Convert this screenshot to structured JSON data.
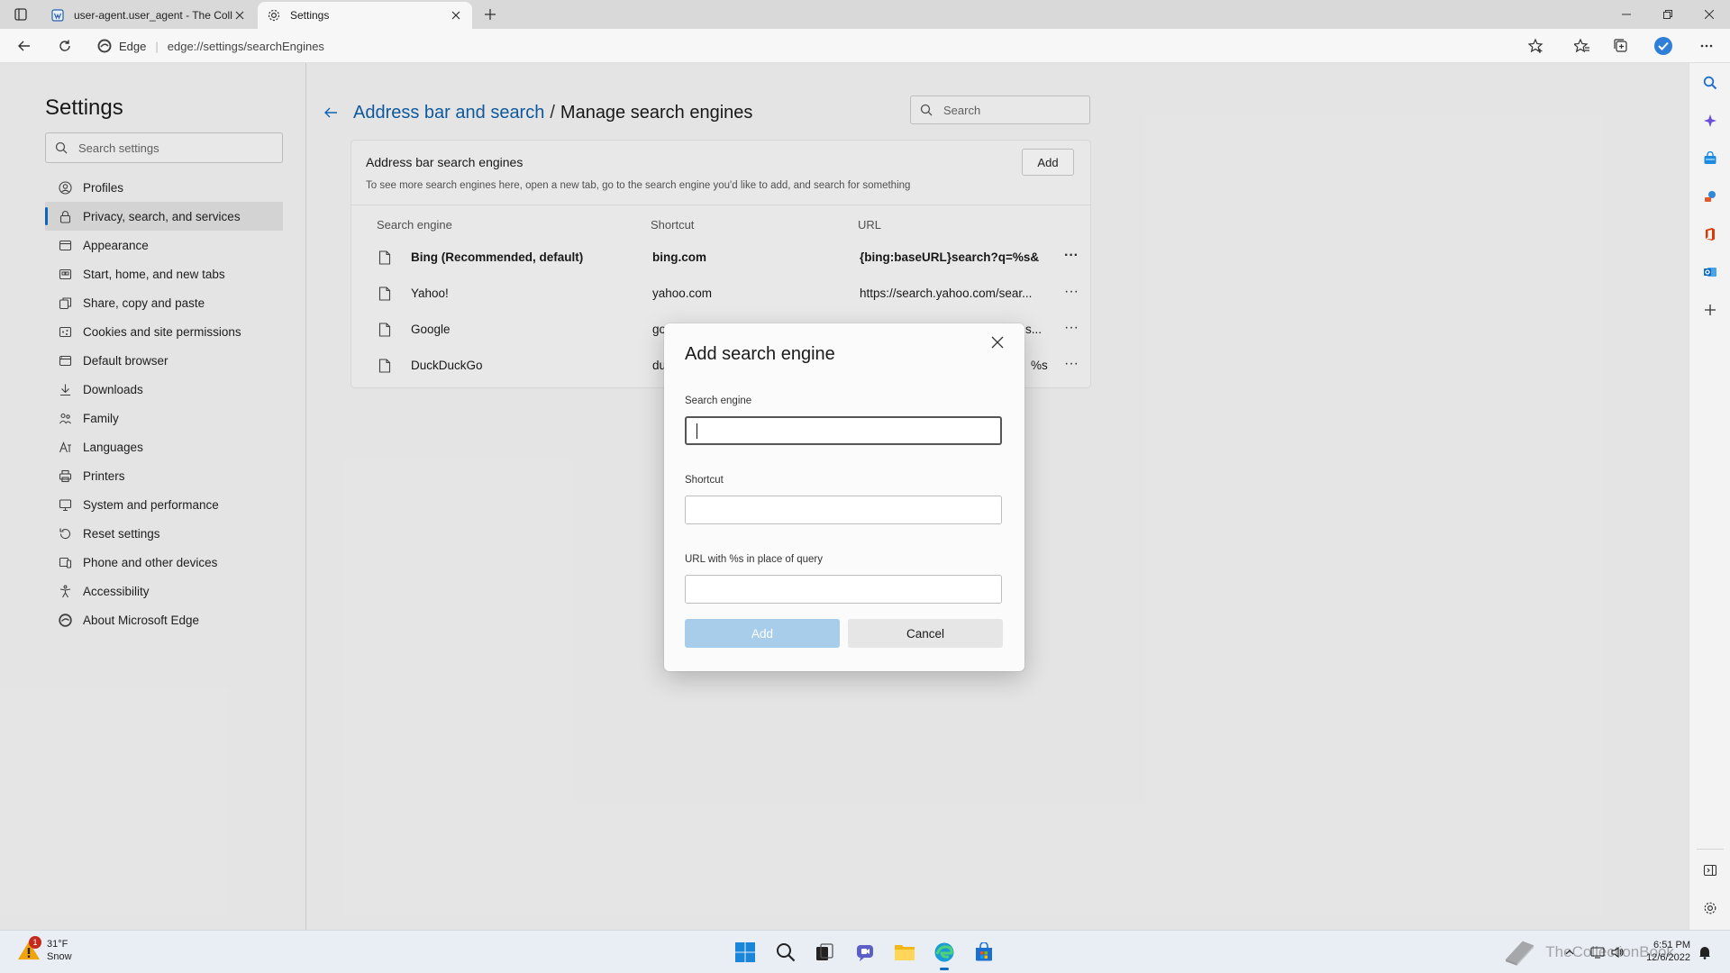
{
  "browser": {
    "tabs": [
      {
        "label": "user-agent.user_agent - The Coll",
        "icon": "page-icon"
      },
      {
        "label": "Settings",
        "icon": "gear-icon"
      }
    ],
    "address": {
      "site_label": "Edge",
      "url": "edge://settings/searchEngines"
    }
  },
  "sidebar": {
    "title": "Settings",
    "search_placeholder": "Search settings",
    "items": [
      {
        "label": "Profiles",
        "icon": "person-icon"
      },
      {
        "label": "Privacy, search, and services",
        "icon": "lock-icon",
        "active": true
      },
      {
        "label": "Appearance",
        "icon": "appearance-icon"
      },
      {
        "label": "Start, home, and new tabs",
        "icon": "home-icon"
      },
      {
        "label": "Share, copy and paste",
        "icon": "share-icon"
      },
      {
        "label": "Cookies and site permissions",
        "icon": "cookie-icon"
      },
      {
        "label": "Default browser",
        "icon": "browser-icon"
      },
      {
        "label": "Downloads",
        "icon": "download-icon"
      },
      {
        "label": "Family",
        "icon": "family-icon"
      },
      {
        "label": "Languages",
        "icon": "language-icon"
      },
      {
        "label": "Printers",
        "icon": "printer-icon"
      },
      {
        "label": "System and performance",
        "icon": "system-icon"
      },
      {
        "label": "Reset settings",
        "icon": "reset-icon"
      },
      {
        "label": "Phone and other devices",
        "icon": "phone-icon"
      },
      {
        "label": "Accessibility",
        "icon": "accessibility-icon"
      },
      {
        "label": "About Microsoft Edge",
        "icon": "edge-icon"
      }
    ]
  },
  "main": {
    "breadcrumb_link": "Address bar and search",
    "breadcrumb_separator": "/",
    "breadcrumb_current": "Manage search engines",
    "search_placeholder": "Search",
    "card": {
      "title": "Address bar search engines",
      "description": "To see more search engines here, open a new tab, go to the search engine you'd like to add, and search for something",
      "add_label": "Add",
      "columns": [
        "Search engine",
        "Shortcut",
        "URL"
      ],
      "rows": [
        {
          "name": "Bing (Recommended, default)",
          "shortcut": "bing.com",
          "url": "{bing:baseURL}search?q=%s&...",
          "bold": true
        },
        {
          "name": "Yahoo!",
          "shortcut": "yahoo.com",
          "url": "https://search.yahoo.com/sear..."
        },
        {
          "name": "Google",
          "shortcut": "go",
          "url": "s..."
        },
        {
          "name": "DuckDuckGo",
          "shortcut": "du",
          "url": "%s"
        }
      ]
    }
  },
  "dialog": {
    "title": "Add search engine",
    "fields": [
      {
        "label": "Search engine",
        "value": "",
        "focused": true
      },
      {
        "label": "Shortcut",
        "value": ""
      },
      {
        "label": "URL with %s in place of query",
        "value": ""
      }
    ],
    "add_label": "Add",
    "cancel_label": "Cancel"
  },
  "taskbar": {
    "weather": {
      "temp": "31°F",
      "condition": "Snow",
      "badge": "1"
    },
    "clock": {
      "time": "6:51 PM",
      "date": "12/6/2022"
    },
    "watermark": "TheCollectionBook"
  },
  "colors": {
    "accent": "#0f6cbd",
    "link": "#0f5fa8",
    "disabled_button": "#a8cdea"
  }
}
